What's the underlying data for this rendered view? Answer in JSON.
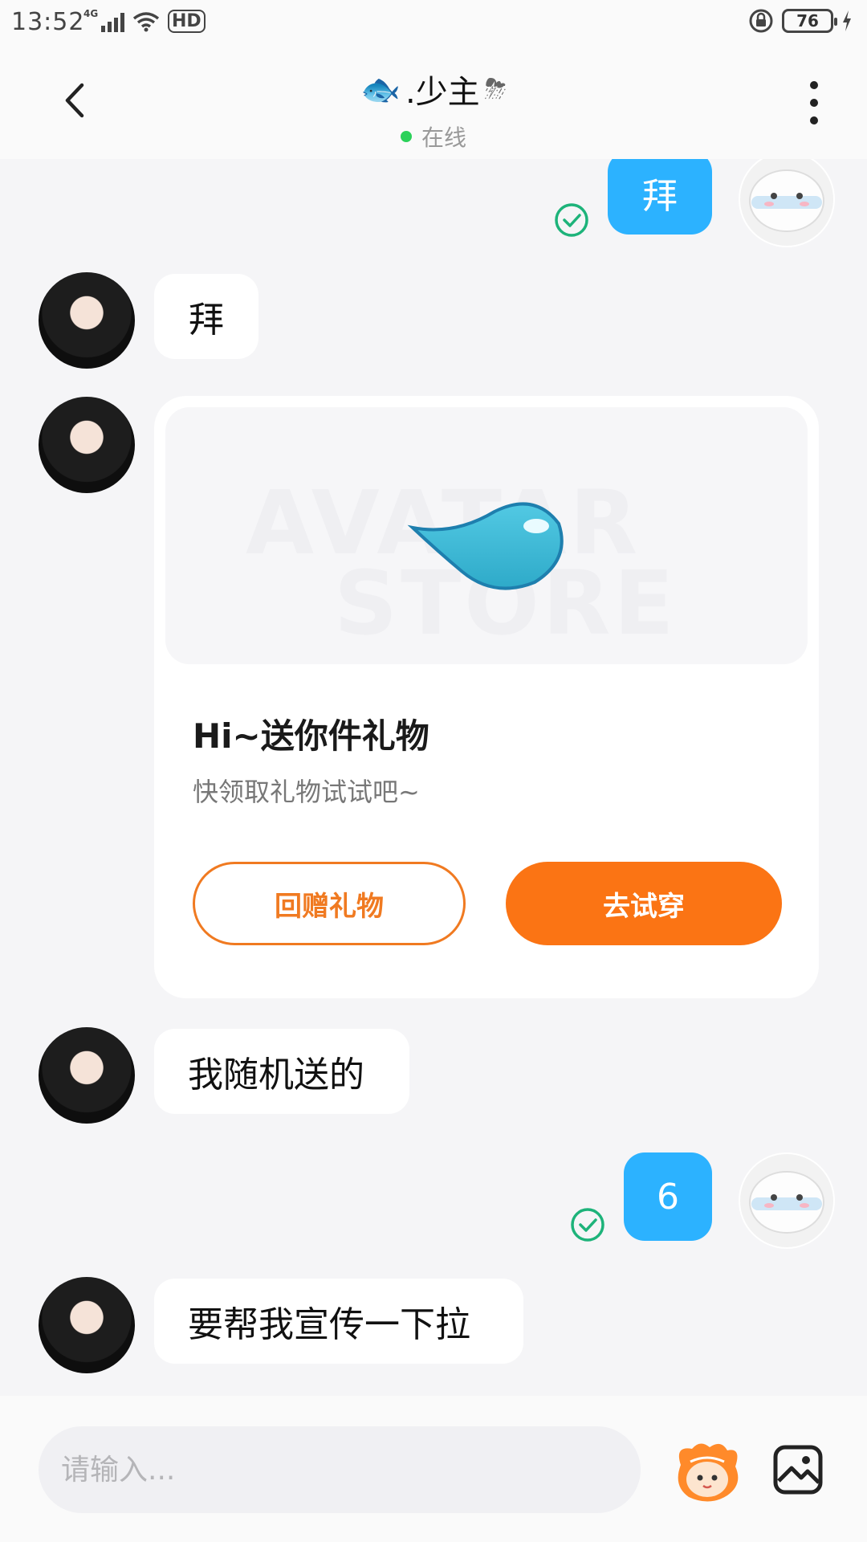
{
  "status_bar": {
    "time": "13:52",
    "network": "4G",
    "hd": "HD",
    "battery": "76"
  },
  "header": {
    "title_emoji": "🐟",
    "title": ".少主",
    "title_suffix_emoji": "⛈",
    "status": "在线"
  },
  "messages": [
    {
      "from": "me",
      "text": "拜",
      "read": true
    },
    {
      "from": "peer",
      "text": "拜"
    },
    {
      "from": "peer",
      "type": "gift",
      "watermark_line1": "AVATAR",
      "watermark_line2": "STORE",
      "title": "Hi~送你件礼物",
      "subtitle": "快领取礼物试试吧~",
      "btn_return": "回赠礼物",
      "btn_try": "去试穿"
    },
    {
      "from": "peer",
      "text": "我随机送的"
    },
    {
      "from": "me",
      "text": "6",
      "read": true
    },
    {
      "from": "peer",
      "text": "要帮我宣传一下拉"
    }
  ],
  "input": {
    "placeholder": "请输入..."
  },
  "icons": {
    "back": "back-arrow-icon",
    "more": "more-vertical-icon",
    "emoji": "emoji-mascot-icon",
    "image": "image-picker-icon",
    "read": "check-circle-icon"
  },
  "colors": {
    "accent_blue": "#2cb2ff",
    "accent_orange": "#fb7414",
    "online_green": "#2bd159"
  }
}
